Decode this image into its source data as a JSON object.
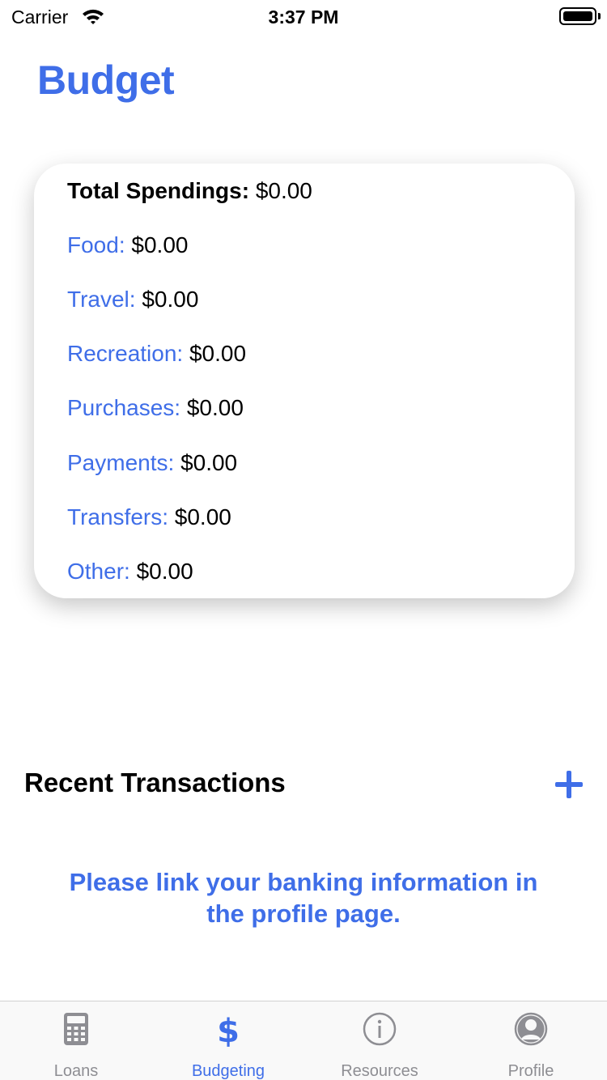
{
  "status_bar": {
    "carrier": "Carrier",
    "time": "3:37 PM",
    "icons": [
      "wifi-icon",
      "battery-icon"
    ]
  },
  "page_title": "Budget",
  "spending": {
    "total_label": "Total Spendings:",
    "total_amount": "$0.00",
    "categories": [
      {
        "label": "Food:",
        "amount": "$0.00"
      },
      {
        "label": "Travel:",
        "amount": "$0.00"
      },
      {
        "label": "Recreation:",
        "amount": "$0.00"
      },
      {
        "label": "Purchases:",
        "amount": "$0.00"
      },
      {
        "label": "Payments:",
        "amount": "$0.00"
      },
      {
        "label": "Transfers:",
        "amount": "$0.00"
      },
      {
        "label": "Other:",
        "amount": "$0.00"
      }
    ]
  },
  "transactions": {
    "title": "Recent Transactions",
    "add_icon": "plus-icon",
    "empty_message": "Please link your banking information in the profile page."
  },
  "tab_bar": {
    "tabs": [
      {
        "label": "Loans",
        "icon": "calculator-icon",
        "active": false
      },
      {
        "label": "Budgeting",
        "icon": "dollar-icon",
        "active": true
      },
      {
        "label": "Resources",
        "icon": "info-icon",
        "active": false
      },
      {
        "label": "Profile",
        "icon": "person-icon",
        "active": false
      }
    ]
  },
  "colors": {
    "accent": "#3f6ee8",
    "inactive_tab": "#8e8e93"
  }
}
